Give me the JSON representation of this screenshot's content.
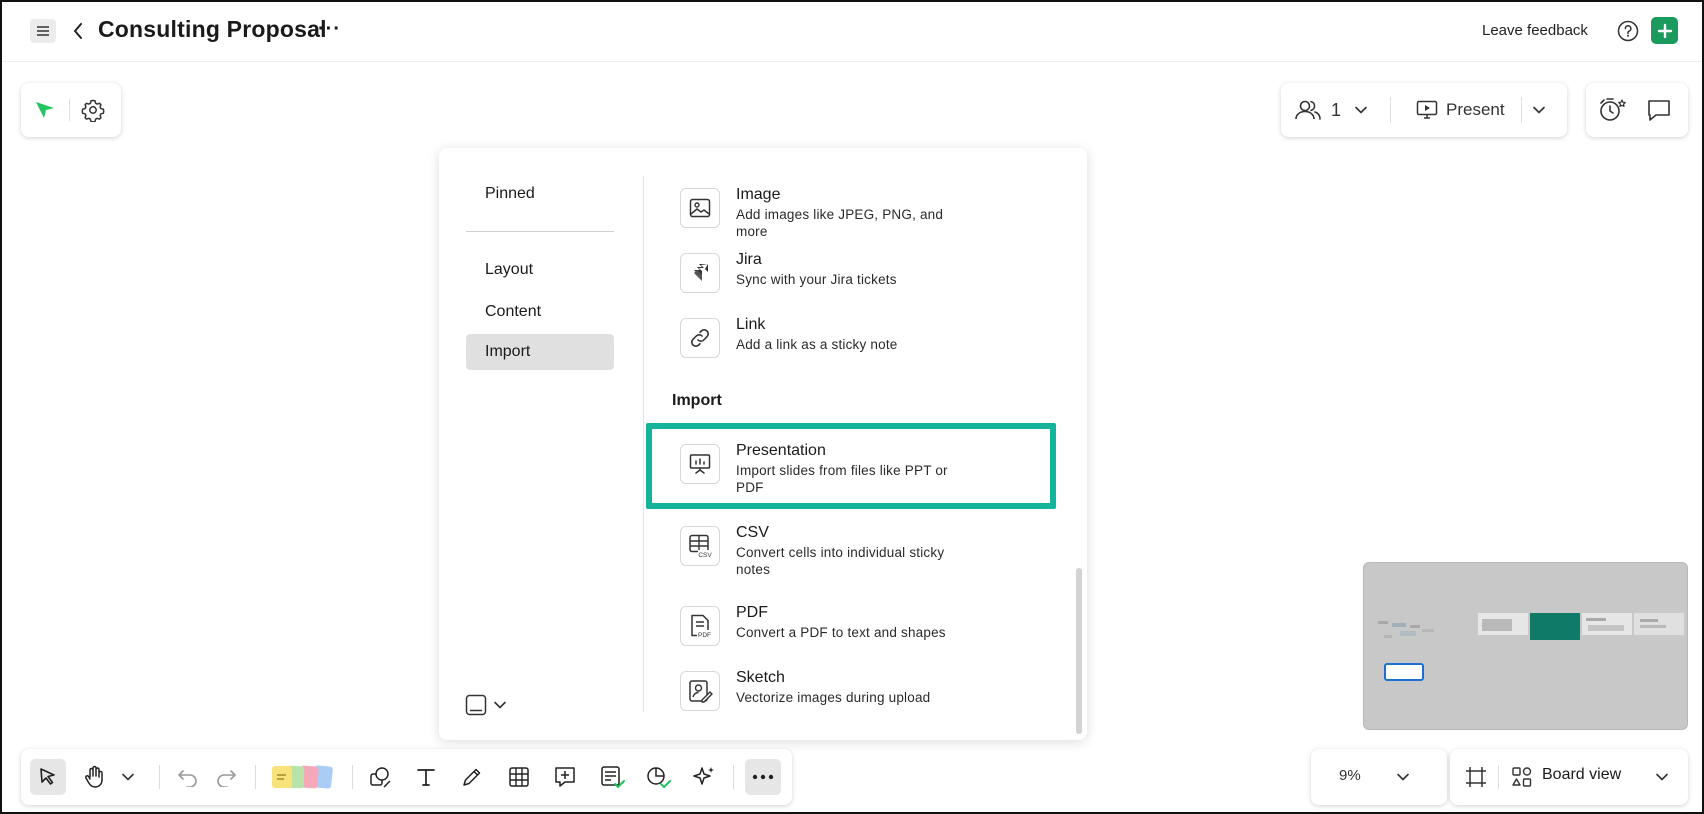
{
  "header": {
    "title": "Consulting Proposal",
    "more": "···",
    "feedback": "Leave feedback"
  },
  "collaboration": {
    "user_count": "1",
    "present_label": "Present"
  },
  "dialog": {
    "sidebar": {
      "items": [
        {
          "label": "Pinned"
        },
        {
          "label": "Layout"
        },
        {
          "label": "Content"
        },
        {
          "label": "Import",
          "selected": true
        }
      ]
    },
    "content_items": [
      {
        "title": "Image",
        "desc": "Add images like JPEG, PNG, and more",
        "icon": "image-icon"
      },
      {
        "title": "Jira",
        "desc": "Sync with your Jira tickets",
        "icon": "jira-icon"
      },
      {
        "title": "Link",
        "desc": "Add a link as a sticky note",
        "icon": "link-icon"
      }
    ],
    "import_section_title": "Import",
    "import_items": [
      {
        "title": "Presentation",
        "desc": "Import slides from files like PPT or PDF",
        "icon": "presentation-icon",
        "highlighted": true
      },
      {
        "title": "CSV",
        "desc": "Convert cells into individual sticky notes",
        "icon": "csv-icon",
        "icon_text": "CSV"
      },
      {
        "title": "PDF",
        "desc": "Convert a PDF to text and shapes",
        "icon": "pdf-icon",
        "icon_text": "PDF"
      },
      {
        "title": "Sketch",
        "desc": "Vectorize images during upload",
        "icon": "sketch-icon"
      }
    ]
  },
  "zoom": {
    "value": "9%"
  },
  "board_view": {
    "label": "Board view"
  },
  "colors": {
    "accent_green": "#1a9a5c",
    "highlight_teal": "#14b39a",
    "cursor_green": "#22c55e"
  }
}
